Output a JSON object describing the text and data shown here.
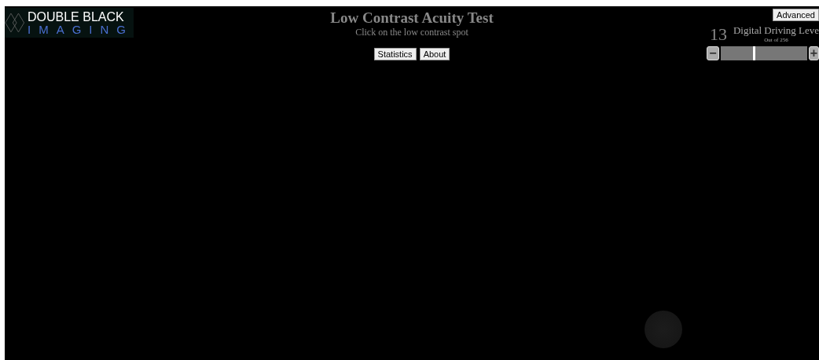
{
  "logo": {
    "line_1": "DOUBLE BLACK",
    "line_2": "IMAGING"
  },
  "header": {
    "title": "Low Contrast Acuity Test",
    "subtitle": "Click on the low contrast spot"
  },
  "buttons": [
    {
      "label": "Statistics"
    },
    {
      "label": "About"
    }
  ],
  "advanced_button": {
    "label": "Advanced"
  },
  "level_control": {
    "value": "13",
    "label": "Digital Driving Leve",
    "sublabel": "Out of 256",
    "minus": "−",
    "plus": "+",
    "level": 0.39
  },
  "test_area": {
    "spot": {
      "kind": "circle"
    }
  }
}
